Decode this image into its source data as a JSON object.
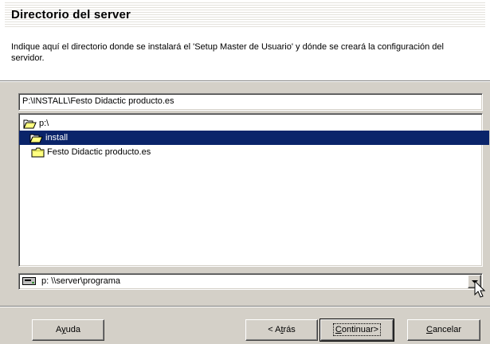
{
  "header": {
    "title": "Directorio del server",
    "description": "Indique aquí el directorio donde se instalará el 'Setup Master de Usuario' y dónde se creará la configuración del servidor."
  },
  "path_field": {
    "value": "P:\\INSTALL\\Festo Didactic producto.es"
  },
  "tree": {
    "items": [
      {
        "label": "p:\\",
        "icon": "open-folder-icon",
        "selected": false,
        "level": 0
      },
      {
        "label": "install",
        "icon": "open-folder-icon",
        "selected": true,
        "level": 1
      },
      {
        "label": "Festo Didactic producto.es",
        "icon": "folder-icon",
        "selected": false,
        "level": 1
      }
    ]
  },
  "drive_select": {
    "value": "p:  \\\\server\\programa",
    "icon": "network-drive-icon"
  },
  "buttons": {
    "help": {
      "pre": "A",
      "key": "y",
      "post": "uda"
    },
    "back": {
      "pre": "< A",
      "key": "t",
      "post": "rás"
    },
    "next": {
      "pre": "",
      "key": "C",
      "post": "ontinuar>"
    },
    "cancel": {
      "pre": "",
      "key": "C",
      "post": "ancelar"
    }
  },
  "colors": {
    "selection": "#0a246a",
    "dialog_bg": "#d4d0c8"
  }
}
